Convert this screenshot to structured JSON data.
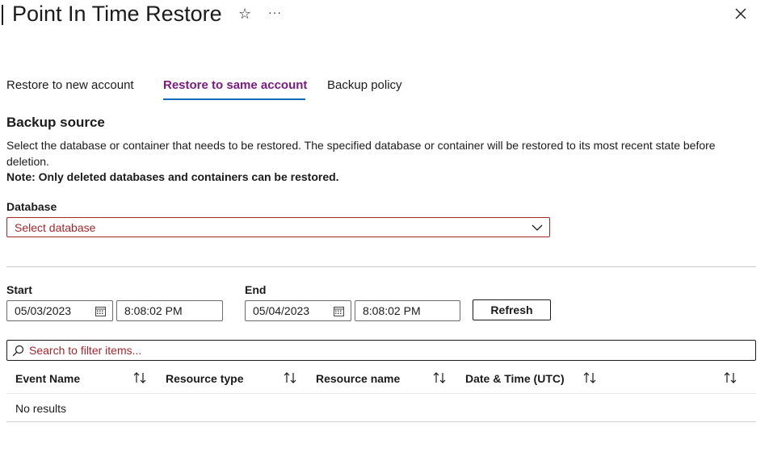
{
  "header": {
    "title": "Point In Time Restore",
    "more": "···"
  },
  "tabs": [
    {
      "label": "Restore to new account",
      "active": false
    },
    {
      "label": "Restore to same account",
      "active": true
    },
    {
      "label": "Backup policy",
      "active": false
    }
  ],
  "backup_source": {
    "heading": "Backup source",
    "description": "Select the database or container that needs to be restored. The specified database or container will be restored to its most recent state before deletion.",
    "note": "Note: Only deleted databases and containers can be restored."
  },
  "database": {
    "label": "Database",
    "placeholder": "Select database"
  },
  "range": {
    "start_label": "Start",
    "start_date": "05/03/2023",
    "start_time": "8:08:02 PM",
    "end_label": "End",
    "end_date": "05/04/2023",
    "end_time": "8:08:02 PM",
    "refresh_label": "Refresh"
  },
  "search": {
    "placeholder": "Search to filter items..."
  },
  "table": {
    "columns": [
      "Event Name",
      "Resource type",
      "Resource name",
      "Date & Time (UTC)"
    ],
    "empty_text": "No results"
  },
  "colors": {
    "active_tab": "#7a1b84",
    "tab_underline": "#0f6cbd",
    "error": "#a4262c"
  }
}
